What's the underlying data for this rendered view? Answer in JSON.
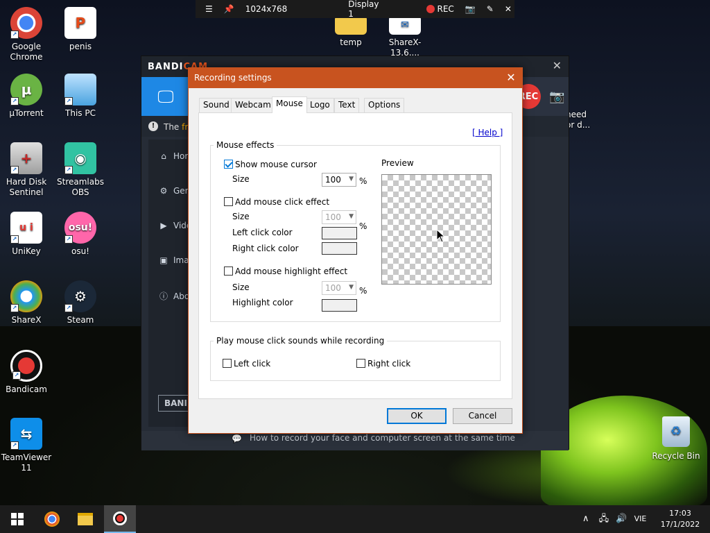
{
  "recorder_bar": {
    "menu_icon": "hamburger-icon",
    "pin_icon": "pin-icon",
    "resolution": "1024x768",
    "display": "Display 1",
    "rec_label": "REC",
    "camera_icon": "camera-icon",
    "pen_icon": "pen-icon",
    "close_icon": "close-icon"
  },
  "desktop": {
    "icons": [
      {
        "label": "Google Chrome",
        "color": "#f4b400"
      },
      {
        "label": "penis",
        "color": "#e64a19"
      },
      {
        "label": "µTorrent",
        "color": "#6ab344"
      },
      {
        "label": "This PC",
        "color": "#4aa3df"
      },
      {
        "label": "Hard Disk Sentinel",
        "color": "#c62828"
      },
      {
        "label": "Streamlabs OBS",
        "color": "#31c3a2"
      },
      {
        "label": "UniKey",
        "color": "#e53935"
      },
      {
        "label": "osu!",
        "color": "#ff66aa"
      },
      {
        "label": "ShareX",
        "color": "#2196f3"
      },
      {
        "label": "Steam",
        "color": "#1b2838"
      },
      {
        "label": "Bandicam",
        "color": "#e53935"
      },
      {
        "label": "TeamViewer 11",
        "color": "#0e8ee9"
      },
      {
        "label": "temp",
        "color": "#f2c94c"
      },
      {
        "label": "ShareX-13.6....",
        "color": "#ffffff"
      }
    ],
    "recycle_bin": "Recycle Bin",
    "need_text_1": "need",
    "need_text_2": "or d..."
  },
  "bandicam": {
    "logo_main": "BANDI",
    "logo_accent": "CAM",
    "notice_prefix": "The",
    "notice_highlight": "fre",
    "sidebar": [
      "Hor",
      "Gen",
      "Vide",
      "Ima",
      "Abo"
    ],
    "bottom_label": "BANI",
    "footer_text": "How to record your face and computer screen at the same time",
    "rec_label": "REC"
  },
  "dialog": {
    "title": "Recording settings",
    "tabs": [
      "Sound",
      "Webcam",
      "Mouse",
      "Logo",
      "Text",
      "Options"
    ],
    "active_tab": "Mouse",
    "help_link": "[ Help ]",
    "mouse_effects": {
      "group_label": "Mouse effects",
      "show_cursor": {
        "label": "Show mouse cursor",
        "checked": true,
        "size_label": "Size",
        "size_value": "100",
        "unit": "%"
      },
      "click_effect": {
        "label": "Add mouse click effect",
        "checked": false,
        "size_label": "Size",
        "size_value": "100",
        "unit": "%",
        "left_color_label": "Left click color",
        "right_color_label": "Right click color"
      },
      "highlight_effect": {
        "label": "Add mouse highlight effect",
        "checked": false,
        "size_label": "Size",
        "size_value": "100",
        "unit": "%",
        "color_label": "Highlight color"
      },
      "preview_label": "Preview"
    },
    "click_sounds": {
      "group_label": "Play mouse click sounds while recording",
      "left": {
        "label": "Left click",
        "checked": false
      },
      "right": {
        "label": "Right click",
        "checked": false
      }
    },
    "ok_label": "OK",
    "cancel_label": "Cancel"
  },
  "taskbar": {
    "language": "VIE",
    "time": "17:03",
    "date": "17/1/2022"
  }
}
